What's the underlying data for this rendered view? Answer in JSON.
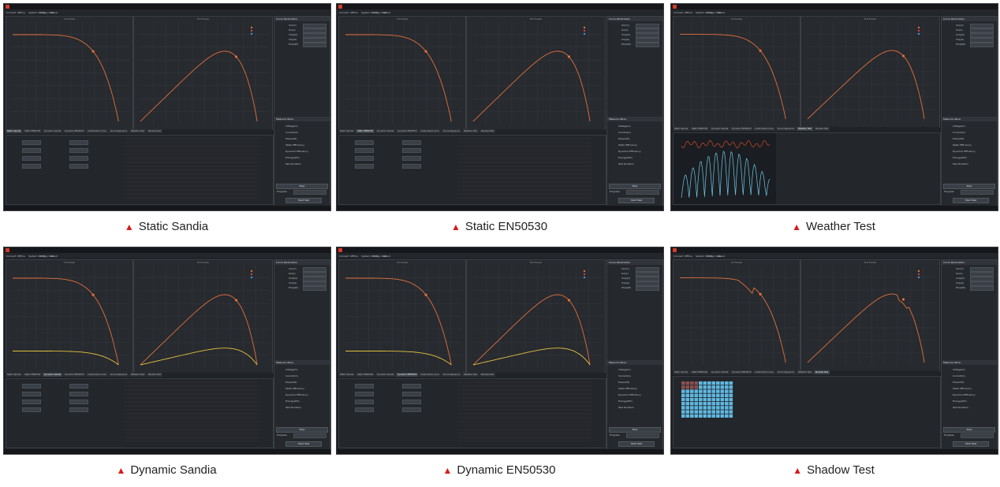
{
  "captions": [
    "Static Sandia",
    "Static EN50530",
    "Weather Test",
    "Dynamic Sandia",
    "Dynamic EN50530",
    "Shadow Test"
  ],
  "window": {
    "menu": [
      "Connect",
      "Offline",
      "System Config",
      "History Data",
      "About"
    ]
  },
  "charts": {
    "iv_title": "I-V Curve",
    "pv_title": "P-V Curve",
    "legend": [
      "MPP",
      "Actual Point"
    ]
  },
  "right_panel": {
    "curve_params_title": "Curve Parameters",
    "curve_params": [
      "Voc(V)",
      "Isc(A)",
      "Vmp(V)",
      "Imp(A)",
      "Pmp(W)"
    ],
    "measure_title": "Measure Value",
    "measure": [
      "Voltage(V)",
      "Current(A)",
      "Power(W)",
      "Static Efficiency",
      "Dynamic Efficiency",
      "Energy(Wh)",
      "Test Duration"
    ],
    "buttons": [
      "Stop",
      "Start Test"
    ],
    "progress_label": "Progress",
    "status_label": "Status"
  },
  "tabs": [
    "Static Sandia",
    "Static EN50530",
    "Dynamic Sandia",
    "Dynamic EN50530",
    "Customized curve",
    "Curve Sequence",
    "Weather Test",
    "Shadow Test"
  ],
  "colors": {
    "accent": "#e0703a",
    "secondary": "#e3c23f",
    "weather_blue": "#6ec8e8",
    "weather_red": "#d44a2a",
    "app_bg": "#1c1f23"
  },
  "variants": [
    {
      "mode": "static",
      "pv_peak": 0.75,
      "shade": false,
      "weather": false,
      "active_tab": 0
    },
    {
      "mode": "static",
      "pv_peak": 0.75,
      "shade": false,
      "weather": false,
      "active_tab": 1
    },
    {
      "mode": "weather",
      "pv_peak": 0.75,
      "shade": false,
      "weather": true,
      "active_tab": 6
    },
    {
      "mode": "dynamic",
      "pv_peak": 0.75,
      "shade": false,
      "weather": false,
      "active_tab": 2
    },
    {
      "mode": "dynamic",
      "pv_peak": 0.75,
      "shade": false,
      "weather": false,
      "active_tab": 3
    },
    {
      "mode": "shadow",
      "pv_peak": 0.75,
      "shade": true,
      "weather": false,
      "active_tab": 7
    }
  ]
}
